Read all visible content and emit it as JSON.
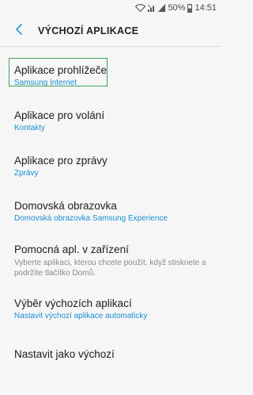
{
  "status_bar": {
    "battery": "50%",
    "time": "14:51"
  },
  "header": {
    "title": "VÝCHOZÍ APLIKACE"
  },
  "items": [
    {
      "title": "Aplikace prohlížeče",
      "subtitle": "Samsung Internet"
    },
    {
      "title": "Aplikace pro volání",
      "subtitle": "Kontakty"
    },
    {
      "title": "Aplikace pro zprávy",
      "subtitle": "Zprávy"
    },
    {
      "title": "Domovská obrazovka",
      "subtitle": "Domovská obrazovka Samsung Experience"
    },
    {
      "title": "Pomocná apl. v zařízení",
      "description": "Vyberte aplikaci, kterou chcete použít, když stisknete a podržíte tlačítko Domů."
    },
    {
      "title": "Výběr výchozích aplikací",
      "subtitle": "Nastavit výchozí aplikace automaticky"
    },
    {
      "title": "Nastavit jako výchozí"
    }
  ],
  "colors": {
    "accent": "#1a8fd1",
    "back_arrow": "#2a9fd6",
    "highlight_box": "#3fa35a"
  }
}
